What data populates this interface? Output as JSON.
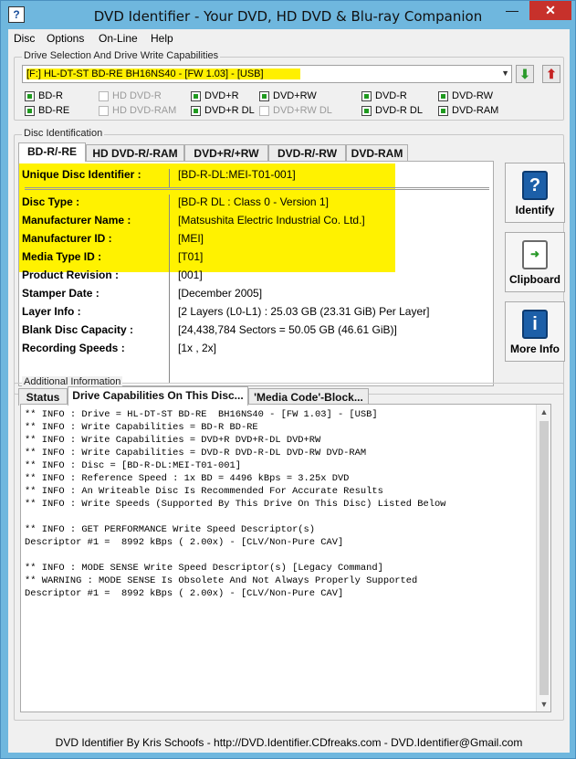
{
  "window": {
    "title": "DVD Identifier - Your DVD, HD DVD & Blu-ray Companion",
    "minimize": "—",
    "close": "✕"
  },
  "menu": [
    "Disc",
    "Options",
    "On-Line",
    "Help"
  ],
  "drive": {
    "group_title": "Drive Selection And Drive Write Capabilities",
    "selected": "[F:] HL-DT-ST BD-RE  BH16NS40 - [FW 1.03] - [USB]",
    "caps": [
      {
        "label": "BD-R",
        "checked": true
      },
      {
        "label": "HD DVD-R",
        "checked": false
      },
      {
        "label": "DVD+R",
        "checked": true
      },
      {
        "label": "DVD+RW",
        "checked": true
      },
      {
        "label": "DVD-R",
        "checked": true
      },
      {
        "label": "DVD-RW",
        "checked": true
      },
      {
        "label": "BD-RE",
        "checked": true
      },
      {
        "label": "HD DVD-RAM",
        "checked": false
      },
      {
        "label": "DVD+R DL",
        "checked": true
      },
      {
        "label": "DVD+RW DL",
        "checked": false
      },
      {
        "label": "DVD-R DL",
        "checked": true
      },
      {
        "label": "DVD-RAM",
        "checked": true
      }
    ],
    "up_icon": "up-arrow-icon",
    "down_icon": "down-arrow-icon"
  },
  "disc": {
    "group_title": "Disc Identification",
    "tabs": [
      "BD-R/-RE",
      "HD DVD-R/-RAM",
      "DVD+R/+RW",
      "DVD-R/-RW",
      "DVD-RAM"
    ],
    "uid_label": "Unique Disc Identifier :",
    "uid_value": "[BD-R-DL:MEI-T01-001]",
    "fields": [
      {
        "label": "Disc Type :",
        "value": "[BD-R DL : Class 0 - Version 1]"
      },
      {
        "label": "Manufacturer Name :",
        "value": "[Matsushita Electric Industrial Co. Ltd.]"
      },
      {
        "label": "Manufacturer ID :",
        "value": "[MEI]"
      },
      {
        "label": "Media Type ID :",
        "value": "[T01]"
      },
      {
        "label": "Product Revision :",
        "value": "[001]"
      },
      {
        "label": "Stamper Date :",
        "value": "[December 2005]"
      },
      {
        "label": "Layer Info :",
        "value": "[2 Layers (L0-L1) : 25.03 GB (23.31 GiB) Per Layer]"
      },
      {
        "label": "Blank Disc Capacity :",
        "value": "[24,438,784 Sectors = 50.05 GB (46.61 GiB)]"
      },
      {
        "label": "Recording Speeds :",
        "value": "[1x , 2x]"
      }
    ],
    "buttons": {
      "identify": "Identify",
      "clipboard": "Clipboard",
      "more": "More Info"
    }
  },
  "additional": {
    "group_title": "Additional Information",
    "tabs": [
      "Status",
      "Drive Capabilities On This Disc...",
      "'Media Code'-Block..."
    ],
    "log": "** INFO : Drive = HL-DT-ST BD-RE  BH16NS40 - [FW 1.03] - [USB]\n** INFO : Write Capabilities = BD-R BD-RE\n** INFO : Write Capabilities = DVD+R DVD+R-DL DVD+RW\n** INFO : Write Capabilities = DVD-R DVD-R-DL DVD-RW DVD-RAM\n** INFO : Disc = [BD-R-DL:MEI-T01-001]\n** INFO : Reference Speed : 1x BD = 4496 kBps = 3.25x DVD\n** INFO : An Writeable Disc Is Recommended For Accurate Results\n** INFO : Write Speeds (Supported By This Drive On This Disc) Listed Below\n\n** INFO : GET PERFORMANCE Write Speed Descriptor(s)\nDescriptor #1 =  8992 kBps ( 2.00x) - [CLV/Non-Pure CAV]\n\n** INFO : MODE SENSE Write Speed Descriptor(s) [Legacy Command]\n** WARNING : MODE SENSE Is Obsolete And Not Always Properly Supported\nDescriptor #1 =  8992 kBps ( 2.00x) - [CLV/Non-Pure CAV]"
  },
  "status": "DVD Identifier By Kris Schoofs  -  http://DVD.Identifier.CDfreaks.com  -  DVD.Identifier@Gmail.com"
}
